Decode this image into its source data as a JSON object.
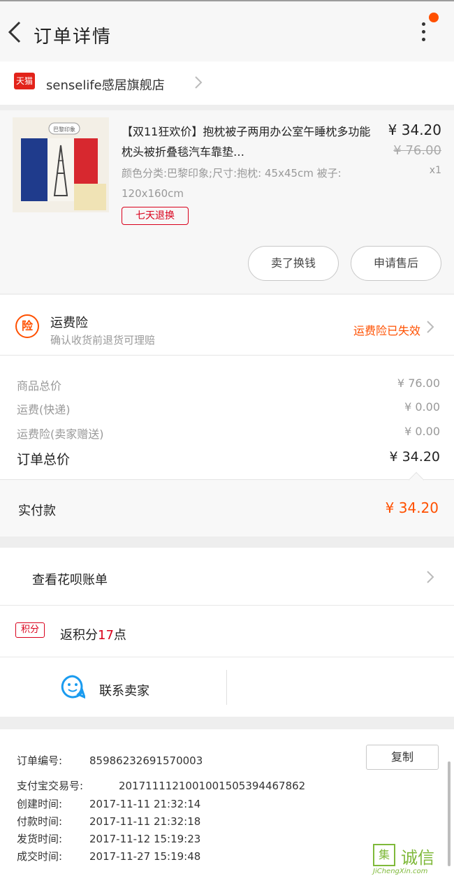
{
  "header": {
    "title": "订单详情"
  },
  "shop": {
    "badge": "天猫",
    "name": "senselife感居旗舰店"
  },
  "product": {
    "title": "【双11狂欢价】抱枕被子两用办公室午睡枕多功能枕头被折叠毯汽车靠垫…",
    "price": "¥ 34.20",
    "original_price": "¥ 76.00",
    "spec": "颜色分类:巴黎印象;尺寸:抱枕: 45x45cm 被子: 120x160cm",
    "quantity": "x1",
    "tag": "七天退换",
    "thumb_label": "巴黎印象",
    "btn_buy_more": "卖了换钱",
    "btn_after_sale": "申请售后"
  },
  "insurance": {
    "icon_text": "险",
    "title": "运费险",
    "desc": "确认收货前退货可理赔",
    "status": "运费险已失效"
  },
  "summary": {
    "rows": [
      {
        "label": "商品总价",
        "value": "¥ 76.00"
      },
      {
        "label": "运费(快递)",
        "value": "¥ 0.00"
      },
      {
        "label": "运费险(卖家赠送)",
        "value": "¥ 0.00"
      }
    ],
    "total_label": "订单总价",
    "total_value": "¥ 34.20"
  },
  "paid": {
    "label": "实付款",
    "value": "¥ 34.20"
  },
  "huabei": {
    "label": "查看花呗账单"
  },
  "points": {
    "badge": "积分",
    "prefix": "返积分",
    "count": "17",
    "suffix": "点"
  },
  "contact": {
    "label": "联系卖家"
  },
  "order": {
    "copy_label": "复制",
    "rows": [
      {
        "label": "订单编号:",
        "value": "85986232691570003"
      },
      {
        "label": "支付宝交易号:",
        "value": "2017111121001001505394467862"
      },
      {
        "label": "创建时间:",
        "value": "2017-11-11 21:32:14"
      },
      {
        "label": "付款时间:",
        "value": "2017-11-11 21:32:18"
      },
      {
        "label": "发货时间:",
        "value": "2017-11-12 15:19:23"
      },
      {
        "label": "成交时间:",
        "value": "2017-11-27 15:19:48"
      }
    ]
  },
  "watermark": {
    "box": "集",
    "cn": "诚信",
    "en": "JiChengXin.com"
  },
  "colors": {
    "accent": "#ff5000",
    "tmall_red": "#d9001b",
    "watermark_green": "#7fb93a"
  }
}
